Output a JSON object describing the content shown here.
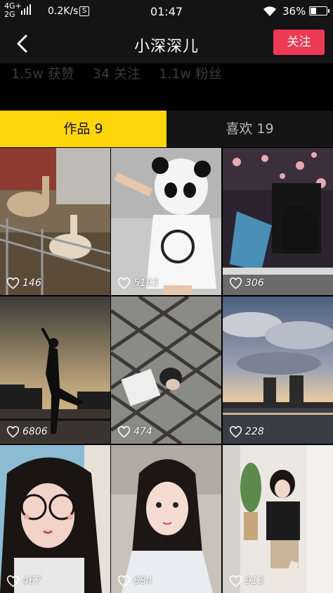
{
  "status_bar": {
    "network_top": "4G+",
    "network_bottom": "2G",
    "speed": "0.2K/s",
    "badge": "S",
    "time": "01:47",
    "battery": "36%",
    "battery_level": 0.36
  },
  "nav": {
    "title": "小深深儿",
    "follow_label": "关注",
    "back_icon": "chevron-left-icon",
    "accent": "#ee3b55"
  },
  "stats": {
    "likes": "1.5w 获赞",
    "following": "34 关注",
    "followers": "1.1w 粉丝"
  },
  "tabs": {
    "works_label": "作品 9",
    "likes_label": "喜欢 19",
    "active_color": "#ffd60a"
  },
  "videos": [
    {
      "likes": "146",
      "scene": "alpacas-in-pen"
    },
    {
      "likes": "5193",
      "scene": "panda-mask-dance"
    },
    {
      "likes": "306",
      "scene": "girl-with-cherry-blossoms"
    },
    {
      "likes": "6806",
      "scene": "dancer-silhouette-sunset"
    },
    {
      "likes": "474",
      "scene": "girl-behind-fence"
    },
    {
      "likes": "228",
      "scene": "clouds-over-water"
    },
    {
      "likes": "467",
      "scene": "girl-with-glasses-filter"
    },
    {
      "likes": "684",
      "scene": "girl-long-hair-selfie"
    },
    {
      "likes": "913",
      "scene": "girl-dancing-in-room"
    }
  ]
}
